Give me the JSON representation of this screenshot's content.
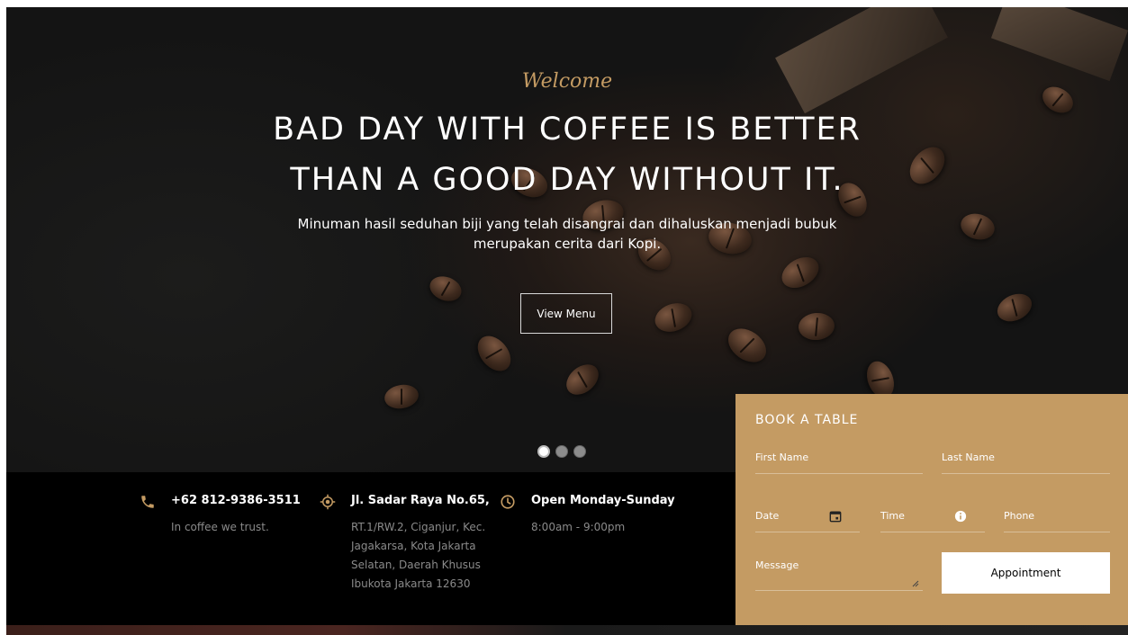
{
  "hero": {
    "welcome": "Welcome",
    "headline_line1": "BAD DAY WITH COFFEE IS BETTER",
    "headline_line2": "THAN A GOOD DAY WITHOUT IT.",
    "subtitle_line1": "Minuman hasil seduhan biji yang telah disangrai dan dihaluskan menjadi bubuk",
    "subtitle_line2": "merupakan cerita dari Kopi.",
    "button_label": "View Menu",
    "slides_total": 3,
    "slide_active": 1
  },
  "info": {
    "phone_title": "+62 812-9386-3511",
    "phone_text": "In coffee we trust.",
    "address_title": "Jl. Sadar Raya No.65,",
    "address_lines": [
      "RT.1/RW.2, Ciganjur, Kec.",
      "Jagakarsa, Kota Jakarta",
      "Selatan, Daerah Khusus",
      "Ibukota Jakarta 12630"
    ],
    "hours_title": "Open Monday-Sunday",
    "hours_text": "8:00am - 9:00pm"
  },
  "booking": {
    "title": "BOOK A TABLE",
    "first_name": "First Name",
    "last_name": "Last Name",
    "date": "Date",
    "time": "Time",
    "phone": "Phone",
    "message": "Message",
    "button_label": "Appointment"
  },
  "colors": {
    "accent": "#c49b63",
    "infobar": "#000000"
  },
  "icons": [
    "phone-icon",
    "location-icon",
    "clock-icon",
    "calendar-icon",
    "time-info-icon"
  ]
}
